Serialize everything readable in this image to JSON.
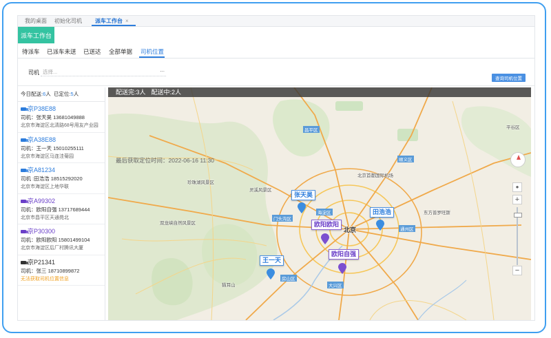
{
  "tabs": [
    "我的桌面",
    "初始化司机",
    "派车工作台"
  ],
  "workbench_button": "派车工作台",
  "subtabs": [
    "待派车",
    "已派车未送",
    "已送达",
    "全部单据",
    "司机位置"
  ],
  "filter": {
    "label": "司机",
    "placeholder": "选择...",
    "more": "...",
    "query_button": "查询司机位置"
  },
  "summary": {
    "today_label": "今日配送:",
    "today_count": "6",
    "today_unit": "人",
    "located_label": "已定位:",
    "located_count": "5",
    "located_unit": "人"
  },
  "drivers": [
    {
      "plate": "京P38E88",
      "driver": "司机：张天昊 13681049888",
      "address": "北京市海淀区北清路68号用友产业园",
      "color": "#2d7ddc"
    },
    {
      "plate": "京A38E88",
      "driver": "司机：王一天 15010255111",
      "address": "北京市海淀区马连洼菊园",
      "color": "#2d7ddc"
    },
    {
      "plate": "京A81234",
      "driver": "司机 :田浩浩 18515292020",
      "address": "北京市海淀区上地华联",
      "color": "#2d7ddc"
    },
    {
      "plate": "京A99302",
      "driver": "司机：欧阳自强 13717689444",
      "address": "北京市昌平区天通苑北",
      "color": "#6a3fc8"
    },
    {
      "plate": "京P30300",
      "driver": "司机：欧阳欧阳 15801499104",
      "address": "北京市海淀区后厂村腾讯大厦",
      "color": "#6a3fc8"
    },
    {
      "plate": "京P21341",
      "driver": "司机：张三 18710899872",
      "address": "无法获取司机位置信息",
      "color": "#333333"
    }
  ],
  "map": {
    "status_done": "配送完:3人",
    "status_ongoing": "配送中:2人",
    "last_time": "最后获取定位时间：2022-06-16 11:30",
    "markers": [
      "张天昊",
      "田浩浩",
      "欧阳欧阳",
      "欧阳自强",
      "王一天"
    ],
    "labels": [
      "北京",
      "海淀区",
      "门头沟区",
      "昌平区",
      "顺义区",
      "通州区",
      "大兴区",
      "房山区",
      "北京首都国际机场",
      "猫耳山",
      "双龙峡自然风景区",
      "珍珠湖风景区",
      "灵溪风景区",
      "东方普罗旺斯",
      "平谷区"
    ],
    "colors": {
      "blue_marker": "#3b8de0",
      "purple_marker": "#7b4fd0"
    }
  }
}
